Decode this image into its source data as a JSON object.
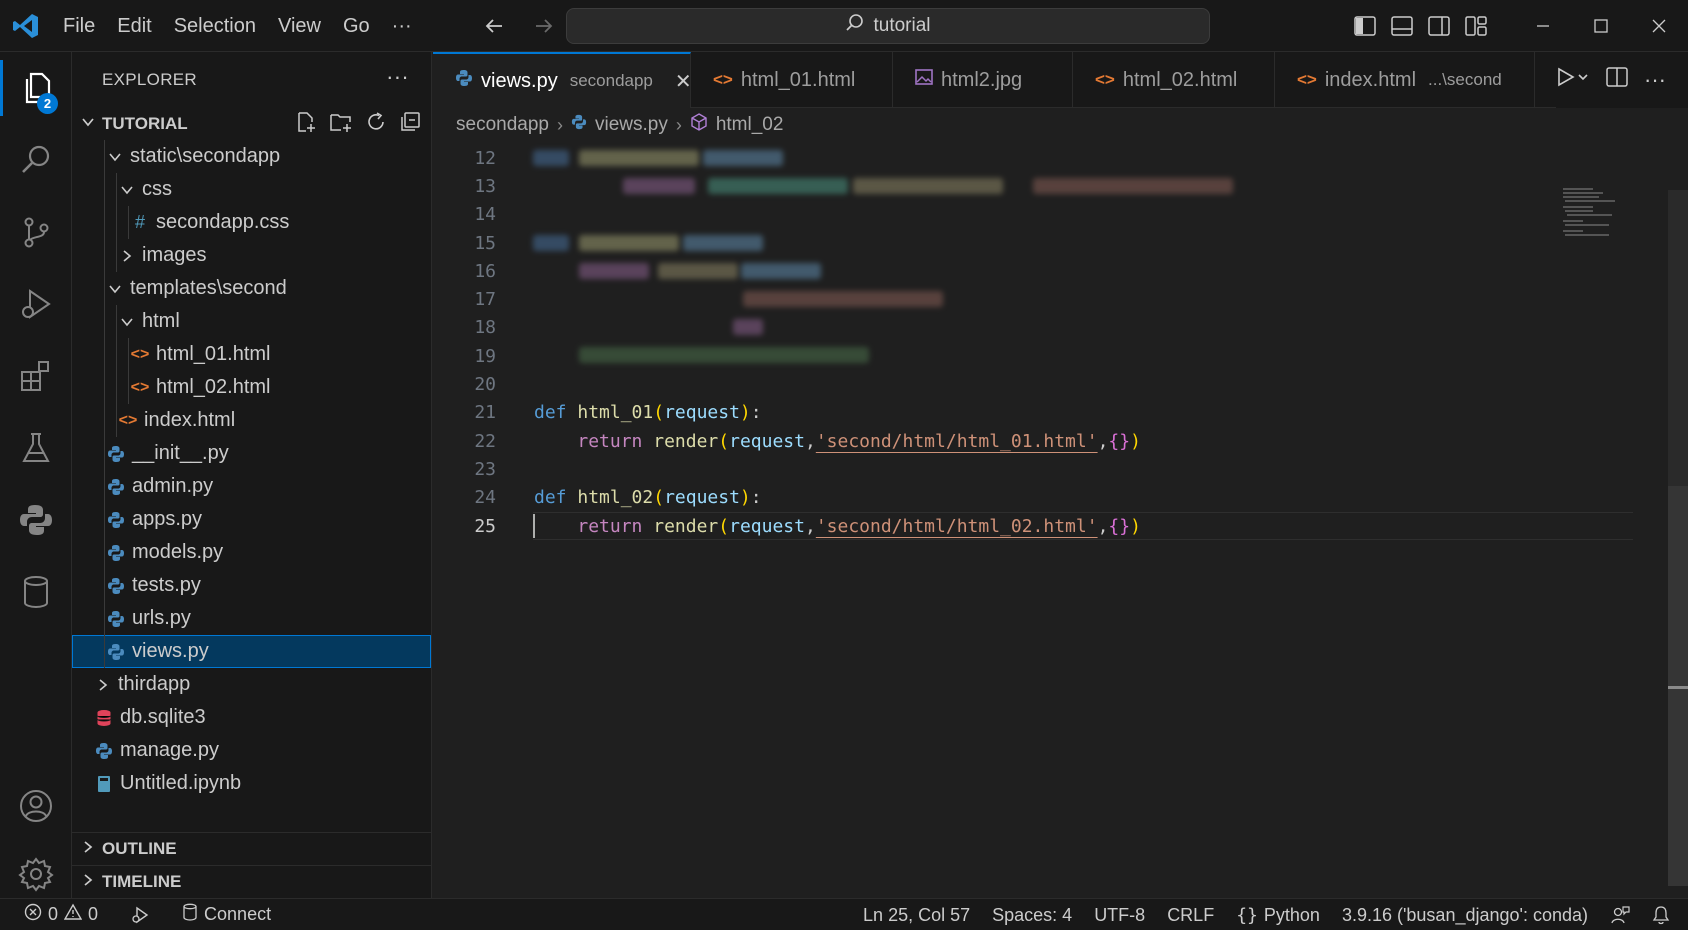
{
  "titlebar": {
    "menu": [
      "File",
      "Edit",
      "Selection",
      "View",
      "Go",
      "···"
    ],
    "search_text": "tutorial"
  },
  "activity": {
    "explorer_badge": "2"
  },
  "sidebar": {
    "header": "EXPLORER",
    "more": "···",
    "section_title": "TUTORIAL",
    "tree": [
      {
        "label": "static\\secondapp",
        "type": "folder-open",
        "depth": 1
      },
      {
        "label": "css",
        "type": "folder-open",
        "depth": 2
      },
      {
        "label": "secondapp.css",
        "type": "css",
        "depth": 3
      },
      {
        "label": "images",
        "type": "folder-closed",
        "depth": 2
      },
      {
        "label": "templates\\second",
        "type": "folder-open",
        "depth": 1
      },
      {
        "label": "html",
        "type": "folder-open",
        "depth": 2
      },
      {
        "label": "html_01.html",
        "type": "html",
        "depth": 3
      },
      {
        "label": "html_02.html",
        "type": "html",
        "depth": 3
      },
      {
        "label": "index.html",
        "type": "html",
        "depth": 2
      },
      {
        "label": "__init__.py",
        "type": "py",
        "depth": 1
      },
      {
        "label": "admin.py",
        "type": "py",
        "depth": 1
      },
      {
        "label": "apps.py",
        "type": "py",
        "depth": 1
      },
      {
        "label": "models.py",
        "type": "py",
        "depth": 1
      },
      {
        "label": "tests.py",
        "type": "py",
        "depth": 1
      },
      {
        "label": "urls.py",
        "type": "py",
        "depth": 1
      },
      {
        "label": "views.py",
        "type": "py",
        "depth": 1,
        "selected": true
      },
      {
        "label": "thirdapp",
        "type": "folder-closed",
        "depth": 0
      },
      {
        "label": "db.sqlite3",
        "type": "db",
        "depth": 0
      },
      {
        "label": "manage.py",
        "type": "py",
        "depth": 0
      },
      {
        "label": "Untitled.ipynb",
        "type": "nb",
        "depth": 0
      }
    ],
    "outline": "OUTLINE",
    "timeline": "TIMELINE"
  },
  "tabs": [
    {
      "label": "views.py",
      "desc": "secondapp",
      "type": "py",
      "active": true
    },
    {
      "label": "html_01.html",
      "desc": "",
      "type": "html",
      "dirty": true
    },
    {
      "label": "html2.jpg",
      "desc": "",
      "type": "img"
    },
    {
      "label": "html_02.html",
      "desc": "",
      "type": "html"
    },
    {
      "label": "index.html",
      "desc": "...\\second",
      "type": "html"
    }
  ],
  "breadcrumbs": [
    "secondapp",
    "views.py",
    "html_02"
  ],
  "code": {
    "line_numbers": [
      "12",
      "13",
      "14",
      "15",
      "16",
      "17",
      "18",
      "19",
      "20",
      "21",
      "22",
      "23",
      "24",
      "25"
    ],
    "current_line": "25",
    "def_kw": "def",
    "return_kw": "return",
    "fn1": "html_01",
    "fn2": "html_02",
    "render": "render",
    "param": "request",
    "str1": "'second/html/html_01.html'",
    "str2": "'second/html/html_02.html'",
    "open_paren": "(",
    "close_paren": ")",
    "colon": ":",
    "comma": ",",
    "braces": "{}"
  },
  "statusbar": {
    "errors": "0",
    "warnings": "0",
    "connect": "Connect",
    "position": "Ln 25, Col 57",
    "spaces": "Spaces: 4",
    "encoding": "UTF-8",
    "eol": "CRLF",
    "language": "Python",
    "interpreter": "3.9.16 ('busan_django': conda)"
  },
  "colors": {
    "accent": "#0078d4",
    "keyword": "#569cd6",
    "control": "#c586c0",
    "function": "#dcdcaa",
    "parameter": "#9cdcfe",
    "string": "#ce9178"
  }
}
